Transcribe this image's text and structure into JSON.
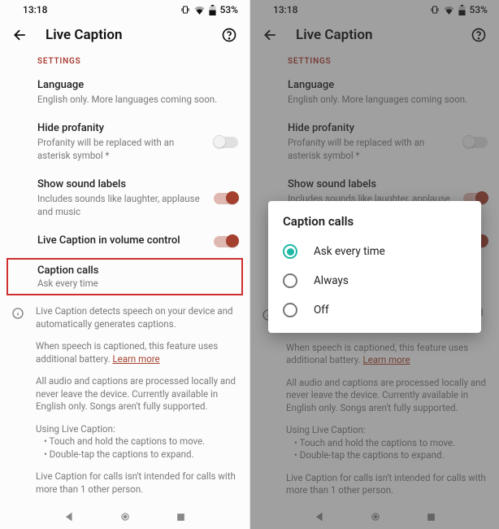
{
  "status": {
    "time": "13:18",
    "battery": "53%"
  },
  "header": {
    "title": "Live Caption"
  },
  "section_label": "SETTINGS",
  "rows": {
    "language": {
      "title": "Language",
      "sub": "English only. More languages coming soon."
    },
    "profanity": {
      "title": "Hide profanity",
      "sub": "Profanity will be replaced with an asterisk symbol *"
    },
    "soundlabels": {
      "title": "Show sound labels",
      "sub": "Includes sounds like laughter, applause and music"
    },
    "volumectrl": {
      "title": "Live Caption in volume control"
    },
    "captioncalls": {
      "title": "Caption calls",
      "sub": "Ask every time"
    }
  },
  "info": {
    "p1": "Live Caption detects speech on your device and automatically generates captions.",
    "p2a": "When speech is captioned, this feature uses additional battery. ",
    "p2_learn": "Learn more",
    "p3": "All audio and captions are processed locally and never leave the device. Currently available in English only. Songs aren't fully supported.",
    "p4_head": "Using Live Caption:",
    "p4_b1": "Touch and hold the captions to move.",
    "p4_b2": "Double-tap the captions to expand.",
    "p5": "Live Caption for calls isn't intended for calls with more than 1 other person."
  },
  "dialog": {
    "title": "Caption calls",
    "options": [
      "Ask every time",
      "Always",
      "Off"
    ],
    "selected": 0
  }
}
